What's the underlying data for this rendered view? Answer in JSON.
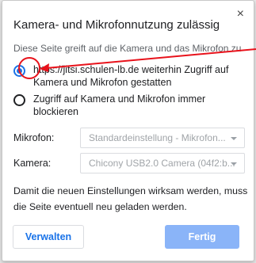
{
  "dialog": {
    "title": "Kamera- und Mikrofonnutzung zulässig",
    "subtitle": "Diese Seite greift auf die Kamera und das Mikrofon zu",
    "close_glyph": "×",
    "options": [
      {
        "label": "https://jitsi.schulen-lb.de weiterhin Zugriff auf Kamera und Mikrofon gestatten",
        "checked": true
      },
      {
        "label": "Zugriff auf Kamera und Mikrofon immer blockieren",
        "checked": false
      }
    ],
    "fields": {
      "microphone_label": "Mikrofon:",
      "microphone_value": "Standardeinstellung - Mikrofon...",
      "camera_label": "Kamera:",
      "camera_value": "Chicony USB2.0 Camera (04f2:b..."
    },
    "info_text": "Damit die neuen Einstellungen wirksam werden, muss die Seite eventuell neu geladen werden.",
    "buttons": {
      "manage": "Verwalten",
      "done": "Fertig"
    }
  },
  "colors": {
    "accent": "#1a73e8",
    "done_button": "#8ab4f8",
    "annotation": "#e8121b"
  },
  "icons": {
    "close": "close-icon",
    "dropdown": "chevron-down-icon"
  }
}
